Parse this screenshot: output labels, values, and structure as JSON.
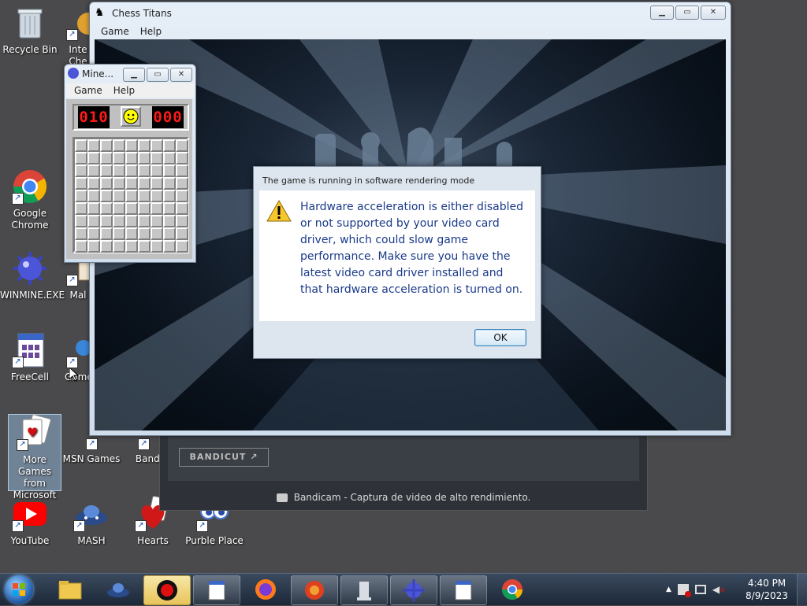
{
  "desktop": {
    "icons": {
      "recycle": "Recycle Bin",
      "internet": "Inte",
      "internet2": "Che",
      "chrome": "Google Chrome",
      "winmine": "WINMINE.EXE",
      "mah": "Mal",
      "freecell": "FreeCell",
      "games": "Game",
      "moregames": "More Games from Microsoft",
      "msn": "MSN Games",
      "bandi": "Bandi",
      "youtube": "YouTube",
      "mash": "MASH",
      "hearts": "Hearts",
      "purble": "Purble Place"
    }
  },
  "chess_window": {
    "title": "Chess Titans",
    "menu": [
      "Game",
      "Help"
    ]
  },
  "minesweeper": {
    "title": "Mine...",
    "menu": [
      "Game",
      "Help"
    ],
    "mine_counter": "010",
    "timer": "000"
  },
  "dialog": {
    "title": "The game is running in software rendering mode",
    "message": "Hardware acceleration is either disabled or not supported by your video card driver, which could slow game performance. Make sure you have the latest video card driver installed and that hardware acceleration is turned on.",
    "ok_label": "OK"
  },
  "bandicam": {
    "bandicut_label": "BANDICUT ↗",
    "status": "Bandicam - Captura de video de alto rendimiento."
  },
  "taskbar": {
    "time": "4:40 PM",
    "date": "8/9/2023"
  },
  "colors": {
    "taskbar_bg": "#1e2a3a",
    "dialog_text": "#1a3a8a",
    "chess_bg": "#0b1420"
  }
}
